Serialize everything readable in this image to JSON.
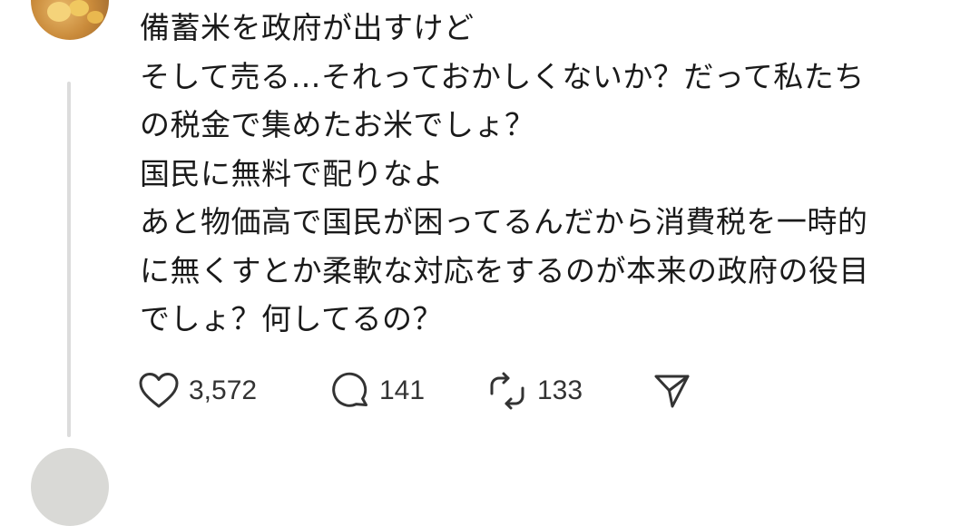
{
  "post": {
    "lines": [
      "備蓄米を政府が出すけど",
      "そして売る…それっておかしくないか？だって私たち",
      "の税金で集めたお米でしょ？",
      "国民に無料で配りなよ",
      "あと物価高で国民が困ってるんだから消費税を一時的",
      "に無くすとか柔軟な対応をするのが本来の政府の役目",
      "でしょ？何してるの？"
    ]
  },
  "actions": {
    "like_count": "3,572",
    "reply_count": "141",
    "repost_count": "133",
    "icons": {
      "like": "heart-icon",
      "reply": "speech-bubble-icon",
      "repost": "repost-icon",
      "share": "send-icon"
    }
  },
  "colors": {
    "text": "#1a1a1a",
    "icon": "#333333",
    "thread_line": "#dcdcdc"
  }
}
